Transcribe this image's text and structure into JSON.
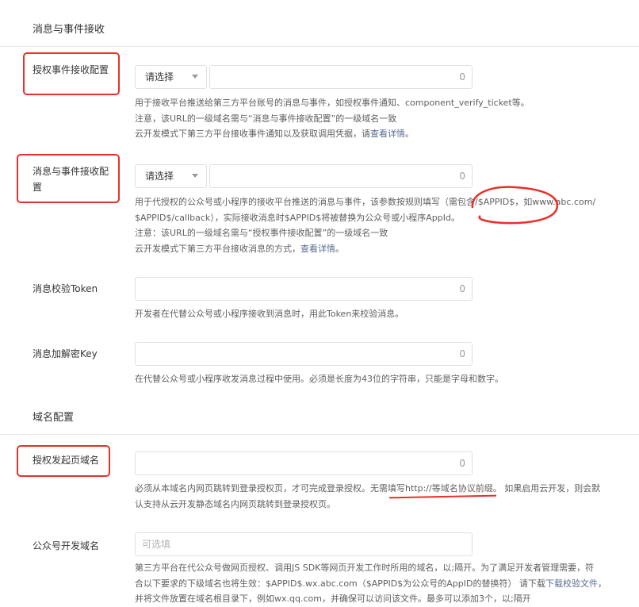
{
  "sections": {
    "messages_title": "消息与事件接收",
    "domain_title": "域名配置"
  },
  "fields": {
    "auth_event_url": {
      "label": "授权事件接收配置",
      "select": "请选择",
      "count": "0",
      "help": [
        "用于接收平台推送给第三方平台账号的消息与事件，如授权事件通知、component_verify_ticket等。",
        "注意，该URL的一级域名需与“消息与事件接收配置”的一级域名一致",
        "云开发模式下第三方平台接收事件通知以及获取调用凭据，请",
        "查看详情",
        "。"
      ]
    },
    "msg_event_url": {
      "label": "消息与事件接收配置",
      "select": "请选择",
      "count": "0",
      "help": [
        "用于代授权的公众号或小程序的接收平台推送的消息与事件，该参数按规则填写（需包含/$APPID$，如www.abc.com/",
        "$APPID$/callback），实际接收消息时$APPID$将被替换为公众号或小程序AppId。",
        "注意：该URL的一级域名需与“授权事件接收配置”的一级域名一致",
        "云开发模式下第三方平台接收消息的方式，",
        "查看详情",
        "。"
      ]
    },
    "token": {
      "label": "消息校验Token",
      "count": "0",
      "help": "开发者在代替公众号或小程序接收到消息时，用此Token来校验消息。"
    },
    "aes_key": {
      "label": "消息加解密Key",
      "count": "0",
      "help": "在代替公众号或小程序收发消息过程中使用。必须是长度为43位的字符串，只能是字母和数字。"
    },
    "auth_domain": {
      "label": "授权发起页域名",
      "count": "0",
      "help": [
        "必须从本域名内网页跳转到登录授权页，才可完成登录授权。",
        "无需填写http://等域名协议前缀",
        "。 如果启用云开发，则会默",
        "认支持从云开发静态域名内网页跳转到登录授权页。"
      ]
    },
    "mp_domain": {
      "label": "公众号开发域名",
      "placeholder": "可选填",
      "help": [
        "第三方平台在代公众号做网页授权、调用JS SDK等网页开发工作时所用的域名，以;隔开。为了满足开发者管理需要，符",
        "合以下要求的下级域名也将生效：$APPID$.wx.abc.com（$APPID$为公众号的AppID的替换符） 请下载",
        "下载校验文件",
        "，",
        "并将文件放置在域名根目录下，例如wx.qq.com，并确保可以访问该文件。最多可以添加3个，以;隔开"
      ]
    }
  },
  "colors": {
    "annotation_red": "#e8302a",
    "link": "#576b95"
  }
}
